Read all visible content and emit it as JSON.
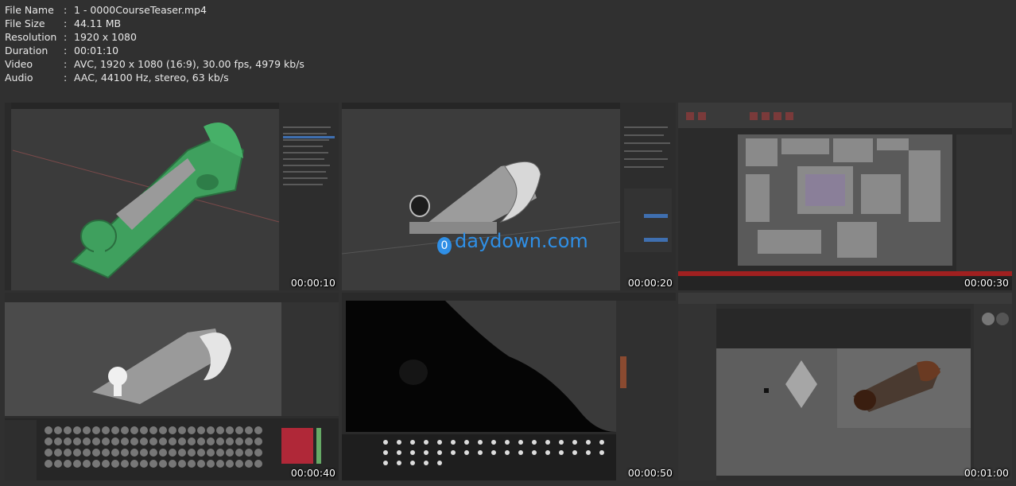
{
  "file_info": [
    {
      "key": "File Name",
      "value": "1 - 0000CourseTeaser.mp4"
    },
    {
      "key": "File Size",
      "value": "44.11 MB"
    },
    {
      "key": "Resolution",
      "value": "1920 x 1080"
    },
    {
      "key": "Duration",
      "value": "00:01:10"
    },
    {
      "key": "Video",
      "value": "AVC, 1920 x 1080 (16:9), 30.00 fps, 4979 kb/s"
    },
    {
      "key": "Audio",
      "value": "AAC, 44100 Hz, stereo, 63 kb/s"
    }
  ],
  "separator": ":",
  "thumbnails": [
    {
      "timestamp": "00:00:10",
      "scene": "green-plane-viewport"
    },
    {
      "timestamp": "00:00:20",
      "scene": "chrome-plane-viewport"
    },
    {
      "timestamp": "00:00:30",
      "scene": "uv-layout"
    },
    {
      "timestamp": "00:00:40",
      "scene": "material-library"
    },
    {
      "timestamp": "00:00:50",
      "scene": "dark-silhouette-brushes"
    },
    {
      "timestamp": "00:01:00",
      "scene": "photo-reference"
    }
  ],
  "watermark": {
    "icon": "0",
    "text": "daydown.com"
  },
  "colors": {
    "background": "#303030",
    "watermark": "#2f8fe6",
    "green_model": "#3fa05e"
  }
}
